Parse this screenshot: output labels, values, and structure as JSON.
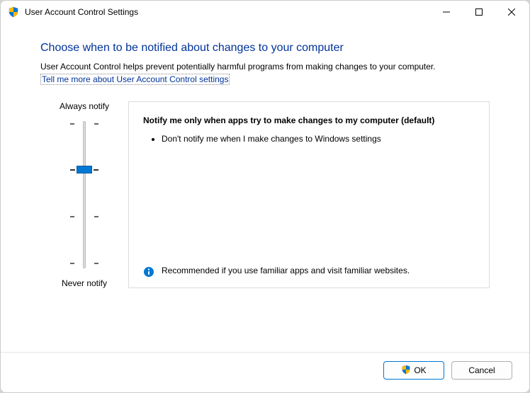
{
  "titlebar": {
    "title": "User Account Control Settings",
    "icon": "shield-icon"
  },
  "content": {
    "heading": "Choose when to be notified about changes to your computer",
    "description": "User Account Control helps prevent potentially harmful programs from making changes to your computer.",
    "link_text": "Tell me more about User Account Control settings"
  },
  "slider": {
    "top_label": "Always notify",
    "bottom_label": "Never notify",
    "levels": 4,
    "current_level": 2
  },
  "info": {
    "title": "Notify me only when apps try to make changes to my computer (default)",
    "bullet": "Don't notify me when I make changes to Windows settings",
    "recommendation": "Recommended if you use familiar apps and visit familiar websites."
  },
  "footer": {
    "ok_label": "OK",
    "cancel_label": "Cancel"
  }
}
